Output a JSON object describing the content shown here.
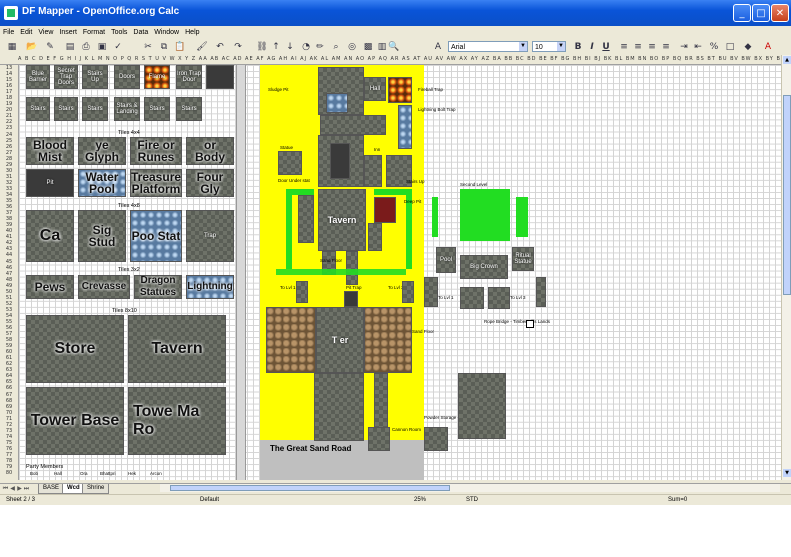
{
  "window": {
    "title": "DF Mapper - OpenOffice.org Calc",
    "min": "_",
    "max": "□",
    "close": "✕"
  },
  "menu": [
    "File",
    "Edit",
    "View",
    "Insert",
    "Format",
    "Tools",
    "Data",
    "Window",
    "Help"
  ],
  "toolbar": {
    "font_name": "Arial",
    "font_size": "10",
    "bold": "B",
    "italic": "I",
    "underline": "U"
  },
  "left_panel": {
    "rows_top": [
      {
        "label": "Blue Barrier"
      },
      {
        "label": "Secret Trap Doors"
      },
      {
        "label": "Stairs Up"
      },
      {
        "label": "Doors"
      },
      {
        "label": "Flame"
      },
      {
        "label": "Iron Trap Door"
      }
    ],
    "rows_second": [
      {
        "label": "Stairs"
      },
      {
        "label": "Stairs"
      },
      {
        "label": "Stairs"
      },
      {
        "label": "Stairs & Landing"
      },
      {
        "label": "Stairs"
      },
      {
        "label": "Stairs"
      }
    ],
    "section_4x4": "Tiles 4x4",
    "tiles_4x4_row1": [
      "Blood Mist",
      "Glyph",
      "Fire or Runes",
      "Body"
    ],
    "tiles_4x4_row1_glyph": "ye",
    "tiles_4x4_row1_body": "or",
    "tiles_4x4_row2": [
      "Pit",
      "Water Pool",
      "Treasure Platform",
      "Four Gly"
    ],
    "tiles_4x4_row2_glyph_top": "Four",
    "tiles_4x4_row2_glyph_bottom": "Gly",
    "section_4x8": "Tiles 4x8",
    "tiles_4x8": [
      "Ca",
      "Sig Stud",
      "Poo Stat",
      "Trap"
    ],
    "section_3x2": "Tiles 3x2",
    "tiles_3x2": [
      "Pews",
      "Crevasse",
      "Dragon Statues",
      "Lightning"
    ],
    "section_big": "Tiles 8x10",
    "tiles_big": [
      "Store",
      "Tavern",
      "Tower Base",
      "Towe Ma Ro"
    ],
    "party_label": "Party Members",
    "party_names": [
      "Bob",
      "Hall",
      "Ora",
      "Bhattpri",
      "Hek",
      "Arcon"
    ]
  },
  "map": {
    "labels": {
      "sludge_pit": "Sludge Pit",
      "fireball_trap": "Fireball Trap",
      "lightning_bolt_trap": "Lightning Bolt Trap",
      "statue": "Statue",
      "door_under_stat": "Door Under stat",
      "hall": "Hall",
      "inn": "Inn",
      "stairs_up": "Stairs Up",
      "tavern": "Tavern",
      "deep_pit": "Deep Pit",
      "second_level": "Second Level",
      "pool": "Pool",
      "big_crown": "Big Crown",
      "bridge_support": "Bridge Support",
      "ritual_statue": "Ritual Statue",
      "pit_trap": "Pit Trap",
      "to_lv1_a": "To Lvl 1",
      "to_lv1_b": "To Lvl 1",
      "to_lv3_a": "To Lvl 3",
      "to_lv3_b": "To Lvl 3",
      "sand_floor": "Sand Floor",
      "rope_bridge": "Rope Bridge - Timber Hills Lands",
      "tower": "T  er",
      "tower_b": "B",
      "powder_storage": "Powder Storage - Weak Cannon",
      "cannon_room": "Cannon Room",
      "great_sand_road": "The Great Sand Road"
    }
  },
  "sheet_tabs": [
    "BASE",
    "Wcd",
    "Shrine"
  ],
  "active_tab": "Wcd",
  "status": {
    "sheet": "Sheet 2 / 3",
    "style": "Default",
    "zoom": "25%",
    "mode": "STD",
    "sum": "Sum=0"
  }
}
